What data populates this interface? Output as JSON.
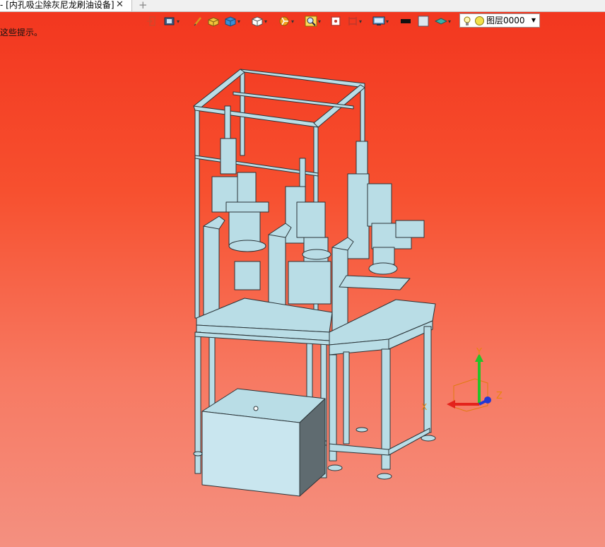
{
  "tab": {
    "title": "- [内孔吸尘除灰尼龙刷油设备]",
    "close_glyph": "✕",
    "add_glyph": "+"
  },
  "hint": {
    "text": "这些提示。"
  },
  "toolbar": {
    "icons": [
      "exit-icon",
      "view-icon",
      "pen-icon",
      "box-icon",
      "solid-box-icon",
      "cube-icon",
      "section-icon",
      "zoom-icon",
      "fit-icon",
      "frame-icon",
      "display-icon",
      "black-fill-icon",
      "white-fill-icon",
      "plane-icon"
    ],
    "layer": {
      "value": "图层0000",
      "dot_color": "#f2e04a"
    }
  },
  "axes": {
    "x": "X",
    "y": "Y",
    "z": "Z"
  },
  "colors": {
    "frame": "#b9dde6",
    "frame_edge": "#2a3438",
    "background_top": "#f2351e",
    "background_bottom": "#f49080"
  }
}
